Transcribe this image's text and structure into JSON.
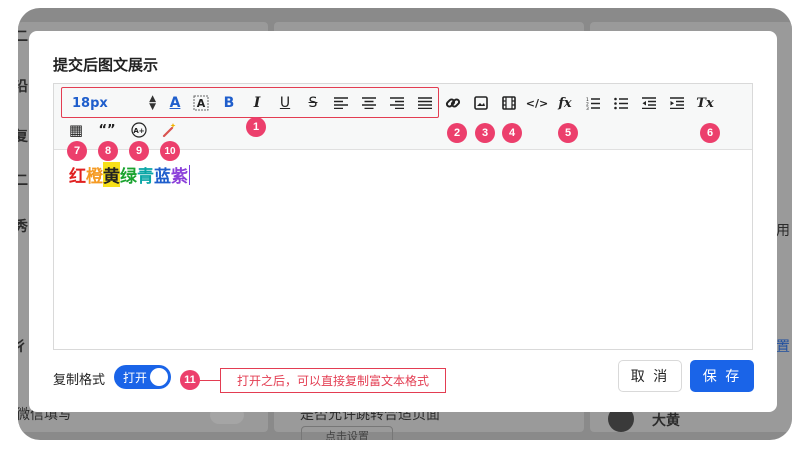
{
  "background": {
    "text_1": "二",
    "text_2": "沿",
    "text_3": "复",
    "text_4": "二",
    "text_5": "秀",
    "text_6": "彳",
    "text_7": "微信填写",
    "text_8": "是否允许跳转合适页面",
    "text_9": "大黄",
    "text_10": "用",
    "text_11": "置",
    "text_12": "点击设置"
  },
  "dialog": {
    "title": "提交后图文展示",
    "toolbar": {
      "font_size": "18px",
      "font_color_glyph": "A",
      "bold_glyph": "B",
      "italic_glyph": "I",
      "underline_glyph": "U",
      "strike_glyph": "S",
      "code_glyph": "</>",
      "formula_glyph": "fx",
      "clear_format_glyph": "Tx",
      "table_glyph": "▦",
      "quote_glyph": "“”",
      "font_size_up_glyph": "A+"
    },
    "badges": [
      "1",
      "2",
      "3",
      "4",
      "5",
      "6",
      "7",
      "8",
      "9",
      "10",
      "11"
    ],
    "content_chars": [
      {
        "ch": "红",
        "color": "#e02020",
        "bg": ""
      },
      {
        "ch": "橙",
        "color": "#f59a23",
        "bg": ""
      },
      {
        "ch": "黄",
        "color": "#222222",
        "bg": "#f7e01a"
      },
      {
        "ch": "绿",
        "color": "#1aa32f",
        "bg": ""
      },
      {
        "ch": "青",
        "color": "#0aa6a6",
        "bg": ""
      },
      {
        "ch": "蓝",
        "color": "#1f5ecc",
        "bg": ""
      },
      {
        "ch": "紫",
        "color": "#8b3fd9",
        "bg": ""
      }
    ],
    "copy_format": {
      "label": "复制格式",
      "toggle_label": "打开",
      "hint": "打开之后，可以直接复制富文本格式"
    },
    "cancel_label": "取 消",
    "save_label": "保 存"
  },
  "colors": {
    "primary": "#1a64e8",
    "annotation": "#e33d52",
    "badge": "#ec3f6c"
  }
}
